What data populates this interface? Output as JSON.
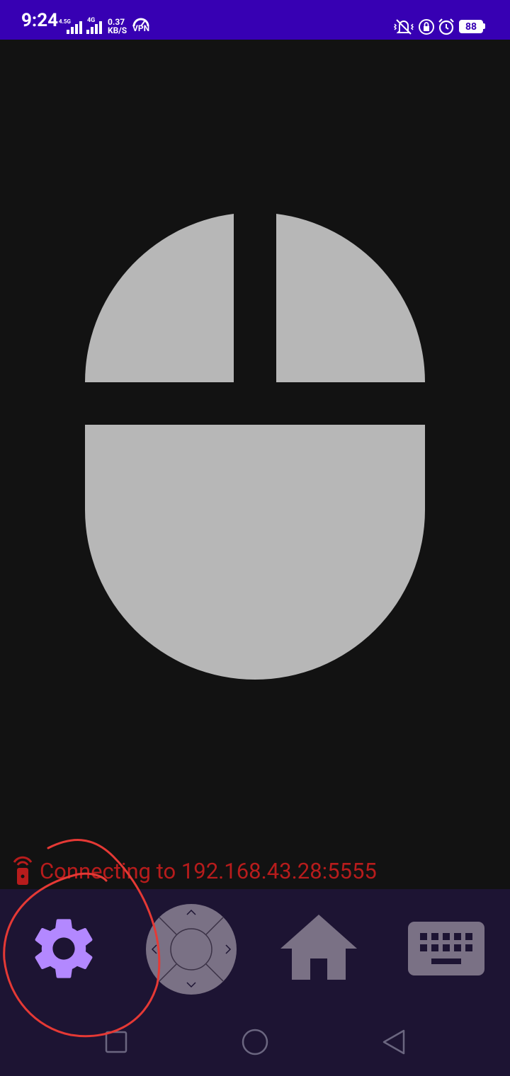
{
  "status_bar": {
    "time": "9:24",
    "network_1": "4.5G",
    "network_2": "4G",
    "speed_value": "0.37",
    "speed_unit": "KB/S",
    "vpn": "VPN",
    "battery": "88",
    "icons": [
      "vibrate-icon",
      "lock-rotation-icon",
      "alarm-icon",
      "battery-icon"
    ]
  },
  "mouse_pad": {
    "left_button": "left-mouse-button",
    "right_button": "right-mouse-button",
    "body": "mouse-body",
    "color": "#b7b7b7"
  },
  "connection": {
    "text": "Connecting to 192.168.43.28:5555",
    "color": "#b71c1c"
  },
  "toolbar": {
    "items": [
      "settings",
      "dpad",
      "home",
      "keyboard"
    ],
    "accent": "#b388ff",
    "muted": "#7a7185"
  },
  "annotation": {
    "color": "#e53935"
  }
}
